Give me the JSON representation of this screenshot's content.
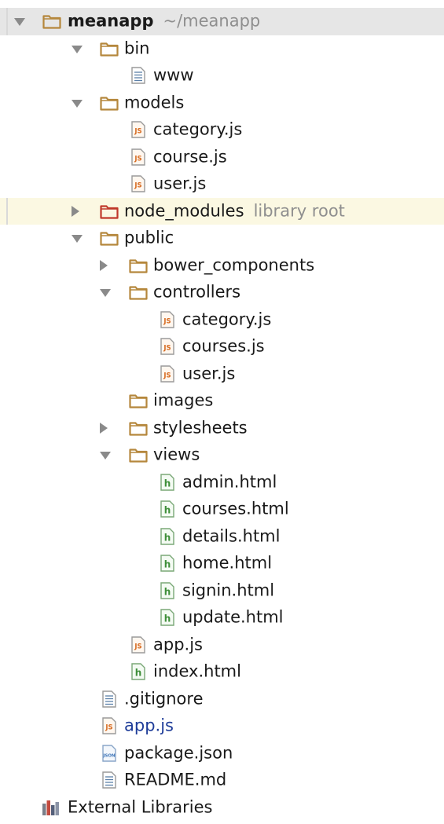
{
  "tree": [
    {
      "level": 0,
      "type": "folder",
      "state": "expanded",
      "label": "meanapp",
      "hint": "~/meanapp",
      "bold": true,
      "style": "root",
      "name": "folder-meanapp"
    },
    {
      "level": 1,
      "type": "folder",
      "state": "expanded",
      "label": "bin",
      "name": "folder-bin"
    },
    {
      "level": 2,
      "type": "text",
      "label": "www",
      "name": "file-www"
    },
    {
      "level": 1,
      "type": "folder",
      "state": "expanded",
      "label": "models",
      "name": "folder-models"
    },
    {
      "level": 2,
      "type": "js",
      "label": "category.js",
      "name": "file-models-category-js"
    },
    {
      "level": 2,
      "type": "js",
      "label": "course.js",
      "name": "file-models-course-js"
    },
    {
      "level": 2,
      "type": "js",
      "label": "user.js",
      "name": "file-models-user-js"
    },
    {
      "level": 1,
      "type": "folder-red",
      "state": "collapsed",
      "label": "node_modules",
      "hint": "library root",
      "style": "highlight",
      "name": "folder-node-modules"
    },
    {
      "level": 1,
      "type": "folder",
      "state": "expanded",
      "label": "public",
      "name": "folder-public"
    },
    {
      "level": 2,
      "type": "folder",
      "state": "collapsed",
      "label": "bower_components",
      "name": "folder-bower-components"
    },
    {
      "level": 2,
      "type": "folder",
      "state": "expanded",
      "label": "controllers",
      "name": "folder-controllers"
    },
    {
      "level": 3,
      "type": "js",
      "label": "category.js",
      "name": "file-controllers-category-js"
    },
    {
      "level": 3,
      "type": "js",
      "label": "courses.js",
      "name": "file-controllers-courses-js"
    },
    {
      "level": 3,
      "type": "js",
      "label": "user.js",
      "name": "file-controllers-user-js"
    },
    {
      "level": 2,
      "type": "folder",
      "state": "leaf",
      "label": "images",
      "name": "folder-images"
    },
    {
      "level": 2,
      "type": "folder",
      "state": "collapsed",
      "label": "stylesheets",
      "name": "folder-stylesheets"
    },
    {
      "level": 2,
      "type": "folder",
      "state": "expanded",
      "label": "views",
      "name": "folder-views"
    },
    {
      "level": 3,
      "type": "html",
      "label": "admin.html",
      "name": "file-admin-html"
    },
    {
      "level": 3,
      "type": "html",
      "label": "courses.html",
      "name": "file-courses-html"
    },
    {
      "level": 3,
      "type": "html",
      "label": "details.html",
      "name": "file-details-html"
    },
    {
      "level": 3,
      "type": "html",
      "label": "home.html",
      "name": "file-home-html"
    },
    {
      "level": 3,
      "type": "html",
      "label": "signin.html",
      "name": "file-signin-html"
    },
    {
      "level": 3,
      "type": "html",
      "label": "update.html",
      "name": "file-update-html"
    },
    {
      "level": 2,
      "type": "js",
      "label": "app.js",
      "name": "file-public-app-js"
    },
    {
      "level": 2,
      "type": "html",
      "label": "index.html",
      "name": "file-index-html"
    },
    {
      "level": 1,
      "type": "text",
      "label": ".gitignore",
      "name": "file-gitignore"
    },
    {
      "level": 1,
      "type": "js",
      "label": "app.js",
      "blue": true,
      "name": "file-root-app-js"
    },
    {
      "level": 1,
      "type": "json",
      "label": "package.json",
      "name": "file-package-json"
    },
    {
      "level": 1,
      "type": "text",
      "label": "README.md",
      "name": "file-readme-md"
    },
    {
      "level": 0,
      "type": "library",
      "state": "leaf",
      "label": "External Libraries",
      "name": "external-libraries",
      "noArrowSpace": true
    }
  ],
  "icons": {
    "folder": "folder-icon",
    "folder-red": "excluded-folder-icon",
    "js": "js-file-icon",
    "html": "html-file-icon",
    "text": "text-file-icon",
    "json": "json-file-icon",
    "library": "library-icon"
  },
  "colors": {
    "folder": "#b5873c",
    "folder_red": "#c0392b",
    "js": "#d66a1f",
    "html": "#3f8f3a",
    "json": "#3d74b8",
    "text": "#5a7fa8",
    "root_bg": "#e6e6e6",
    "highlight_bg": "#fbf8e2",
    "hint_text": "#8f8f8f",
    "blue_text": "#1f3d99"
  },
  "icon_text": {
    "js": "JS",
    "json": "JSON",
    "html": "h"
  }
}
